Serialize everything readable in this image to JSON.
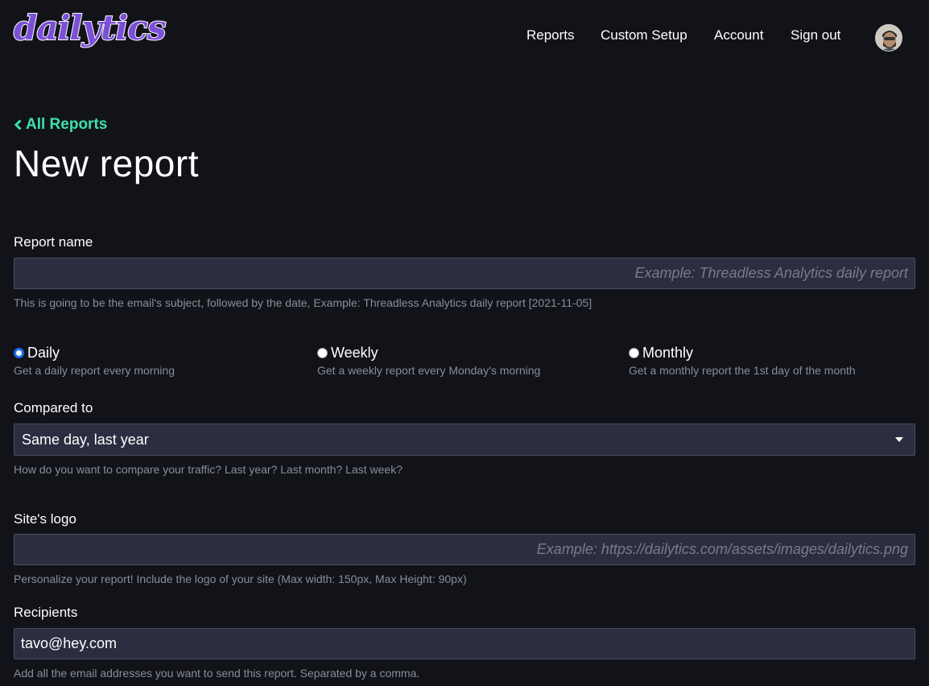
{
  "header": {
    "logo_text": "dailytics",
    "nav": {
      "reports": "Reports",
      "custom_setup": "Custom Setup",
      "account": "Account",
      "sign_out": "Sign out"
    }
  },
  "back_link": "All Reports",
  "page_title": "New report",
  "report_name": {
    "label": "Report name",
    "value": "",
    "placeholder": "Example: Threadless Analytics daily report",
    "help": "This is going to be the email's subject, followed by the date, Example: Threadless Analytics daily report [2021-11-05]"
  },
  "frequency": {
    "selected": "daily",
    "options": [
      {
        "key": "daily",
        "label": "Daily",
        "help": "Get a daily report every morning"
      },
      {
        "key": "weekly",
        "label": "Weekly",
        "help": "Get a weekly report every Monday's morning"
      },
      {
        "key": "monthly",
        "label": "Monthly",
        "help": "Get a monthly report the 1st day of the month"
      }
    ]
  },
  "compared_to": {
    "label": "Compared to",
    "selected": "Same day, last year",
    "help": "How do you want to compare your traffic? Last year? Last month? Last week?"
  },
  "site_logo": {
    "label": "Site's logo",
    "value": "",
    "placeholder": "Example: https://dailytics.com/assets/images/dailytics.png",
    "help": "Personalize your report! Include the logo of your site (Max width: 150px, Max Height: 90px)"
  },
  "recipients": {
    "label": "Recipients",
    "value": "tavo@hey.com",
    "help": "Add all the email addresses you want to send this report. Separated by a comma."
  },
  "colors": {
    "background": "#111319",
    "input_bg": "#2b2e40",
    "accent_link": "#3ee0b0",
    "logo_purple": "#7b4fd8",
    "radio_selected": "#1a6cf0"
  }
}
